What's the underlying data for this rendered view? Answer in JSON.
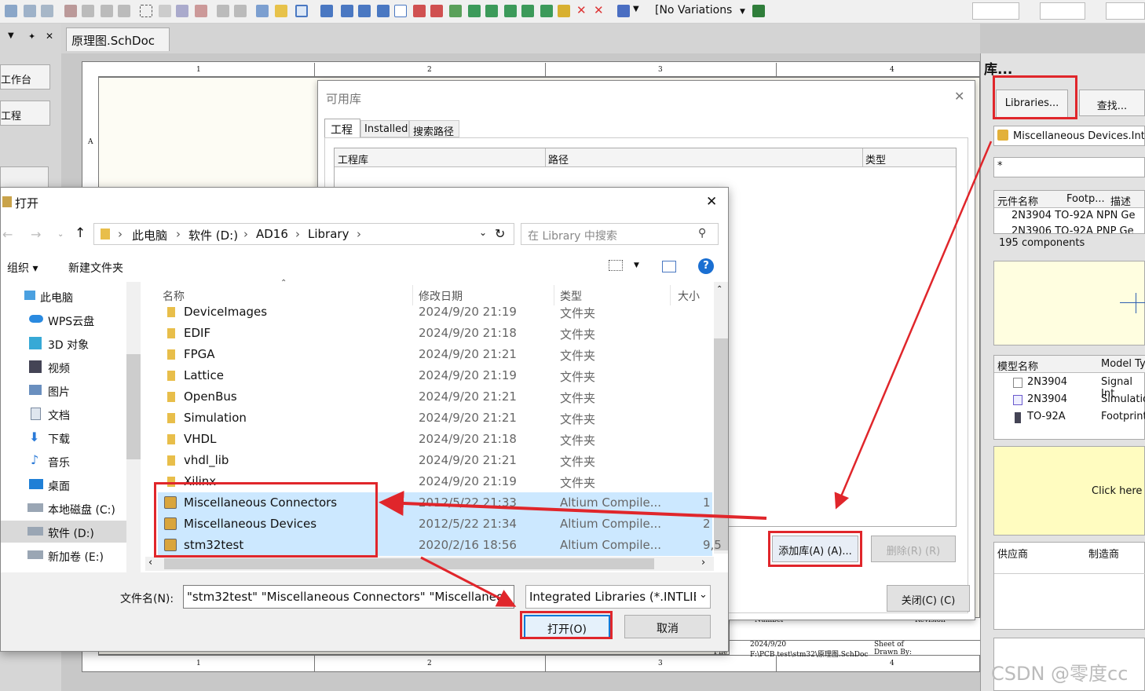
{
  "toolbar": {
    "variations": "[No Variations"
  },
  "left_panel": {
    "workspace": "工作台",
    "project": "工程"
  },
  "doc_tab": {
    "title": "原理图.SchDoc"
  },
  "sheet": {
    "col_labels": [
      "1",
      "2",
      "3",
      "4"
    ],
    "row_label": "A",
    "date": "2024/9/20",
    "file_path": "F:\\PCB test\\stm32\\原理图.SchDoc",
    "number": "Number",
    "revision": "Revision",
    "sheet_of": "Sheet   of",
    "drawn_by": "Drawn By:",
    "file_lbl": "File"
  },
  "lib_panel": {
    "title": "库...",
    "libraries_btn": "Libraries...",
    "search_btn": "查找...",
    "current_lib": "Miscellaneous Devices.IntLib",
    "filter": "*",
    "cols": [
      "元件名称",
      "Footp...",
      "描述"
    ],
    "rows": [
      "2N3904 TO-92A NPN Ge",
      "2N3906 TO-92A PNP Ge"
    ],
    "count": "195 components",
    "model_cols": [
      "模型名称",
      "Model Ty"
    ],
    "models": [
      {
        "name": "2N3904",
        "type": "Signal Int"
      },
      {
        "name": "2N3904",
        "type": "Simulatio"
      },
      {
        "name": "TO-92A",
        "type": "Footprint"
      }
    ],
    "click_here": "Click here t",
    "supplier_cols": [
      "供应商",
      "制造商"
    ]
  },
  "avail_dialog": {
    "title": "可用库",
    "tabs": [
      "工程",
      "Installed",
      "搜索路径"
    ],
    "cols": [
      "工程库",
      "路径",
      "类型"
    ],
    "add_btn": "添加库(A) (A)...",
    "remove_btn": "删除(R) (R)",
    "close_btn": "关闭(C) (C)"
  },
  "open_dialog": {
    "title": "打开",
    "breadcrumb": [
      "此电脑",
      "软件 (D:)",
      "AD16",
      "Library"
    ],
    "search_placeholder": "在 Library 中搜索",
    "organize": "组织 ▾",
    "new_folder": "新建文件夹",
    "nav": [
      "此电脑",
      "WPS云盘",
      "3D 对象",
      "视频",
      "图片",
      "文档",
      "下载",
      "音乐",
      "桌面",
      "本地磁盘 (C:)",
      "软件 (D:)",
      "新加卷 (E:)"
    ],
    "cols": [
      "名称",
      "修改日期",
      "类型",
      "大小"
    ],
    "files": [
      {
        "name": "DeviceImages",
        "date": "2024/9/20 21:19",
        "type": "文件夹",
        "size": ""
      },
      {
        "name": "EDIF",
        "date": "2024/9/20 21:18",
        "type": "文件夹",
        "size": ""
      },
      {
        "name": "FPGA",
        "date": "2024/9/20 21:21",
        "type": "文件夹",
        "size": ""
      },
      {
        "name": "Lattice",
        "date": "2024/9/20 21:19",
        "type": "文件夹",
        "size": ""
      },
      {
        "name": "OpenBus",
        "date": "2024/9/20 21:21",
        "type": "文件夹",
        "size": ""
      },
      {
        "name": "Simulation",
        "date": "2024/9/20 21:21",
        "type": "文件夹",
        "size": ""
      },
      {
        "name": "VHDL",
        "date": "2024/9/20 21:18",
        "type": "文件夹",
        "size": ""
      },
      {
        "name": "vhdl_lib",
        "date": "2024/9/20 21:21",
        "type": "文件夹",
        "size": ""
      },
      {
        "name": "Xilinx",
        "date": "2024/9/20 21:19",
        "type": "文件夹",
        "size": ""
      },
      {
        "name": "Miscellaneous Connectors",
        "date": "2012/5/22 21:33",
        "type": "Altium Compile...",
        "size": "1"
      },
      {
        "name": "Miscellaneous Devices",
        "date": "2012/5/22 21:34",
        "type": "Altium Compile...",
        "size": "2"
      },
      {
        "name": "stm32test",
        "date": "2020/2/16 18:56",
        "type": "Altium Compile...",
        "size": "9,5"
      }
    ],
    "filename_label": "文件名(N):",
    "filename_value": "\"stm32test\" \"Miscellaneous Connectors\" \"Miscellaneo",
    "filetype": "Integrated Libraries (*.INTLIB",
    "open_btn": "打开(O)",
    "cancel_btn": "取消"
  },
  "watermark": "CSDN @零度cc",
  "colors": {
    "accent_red": "#e0262b",
    "select_blue": "#cce8ff"
  }
}
